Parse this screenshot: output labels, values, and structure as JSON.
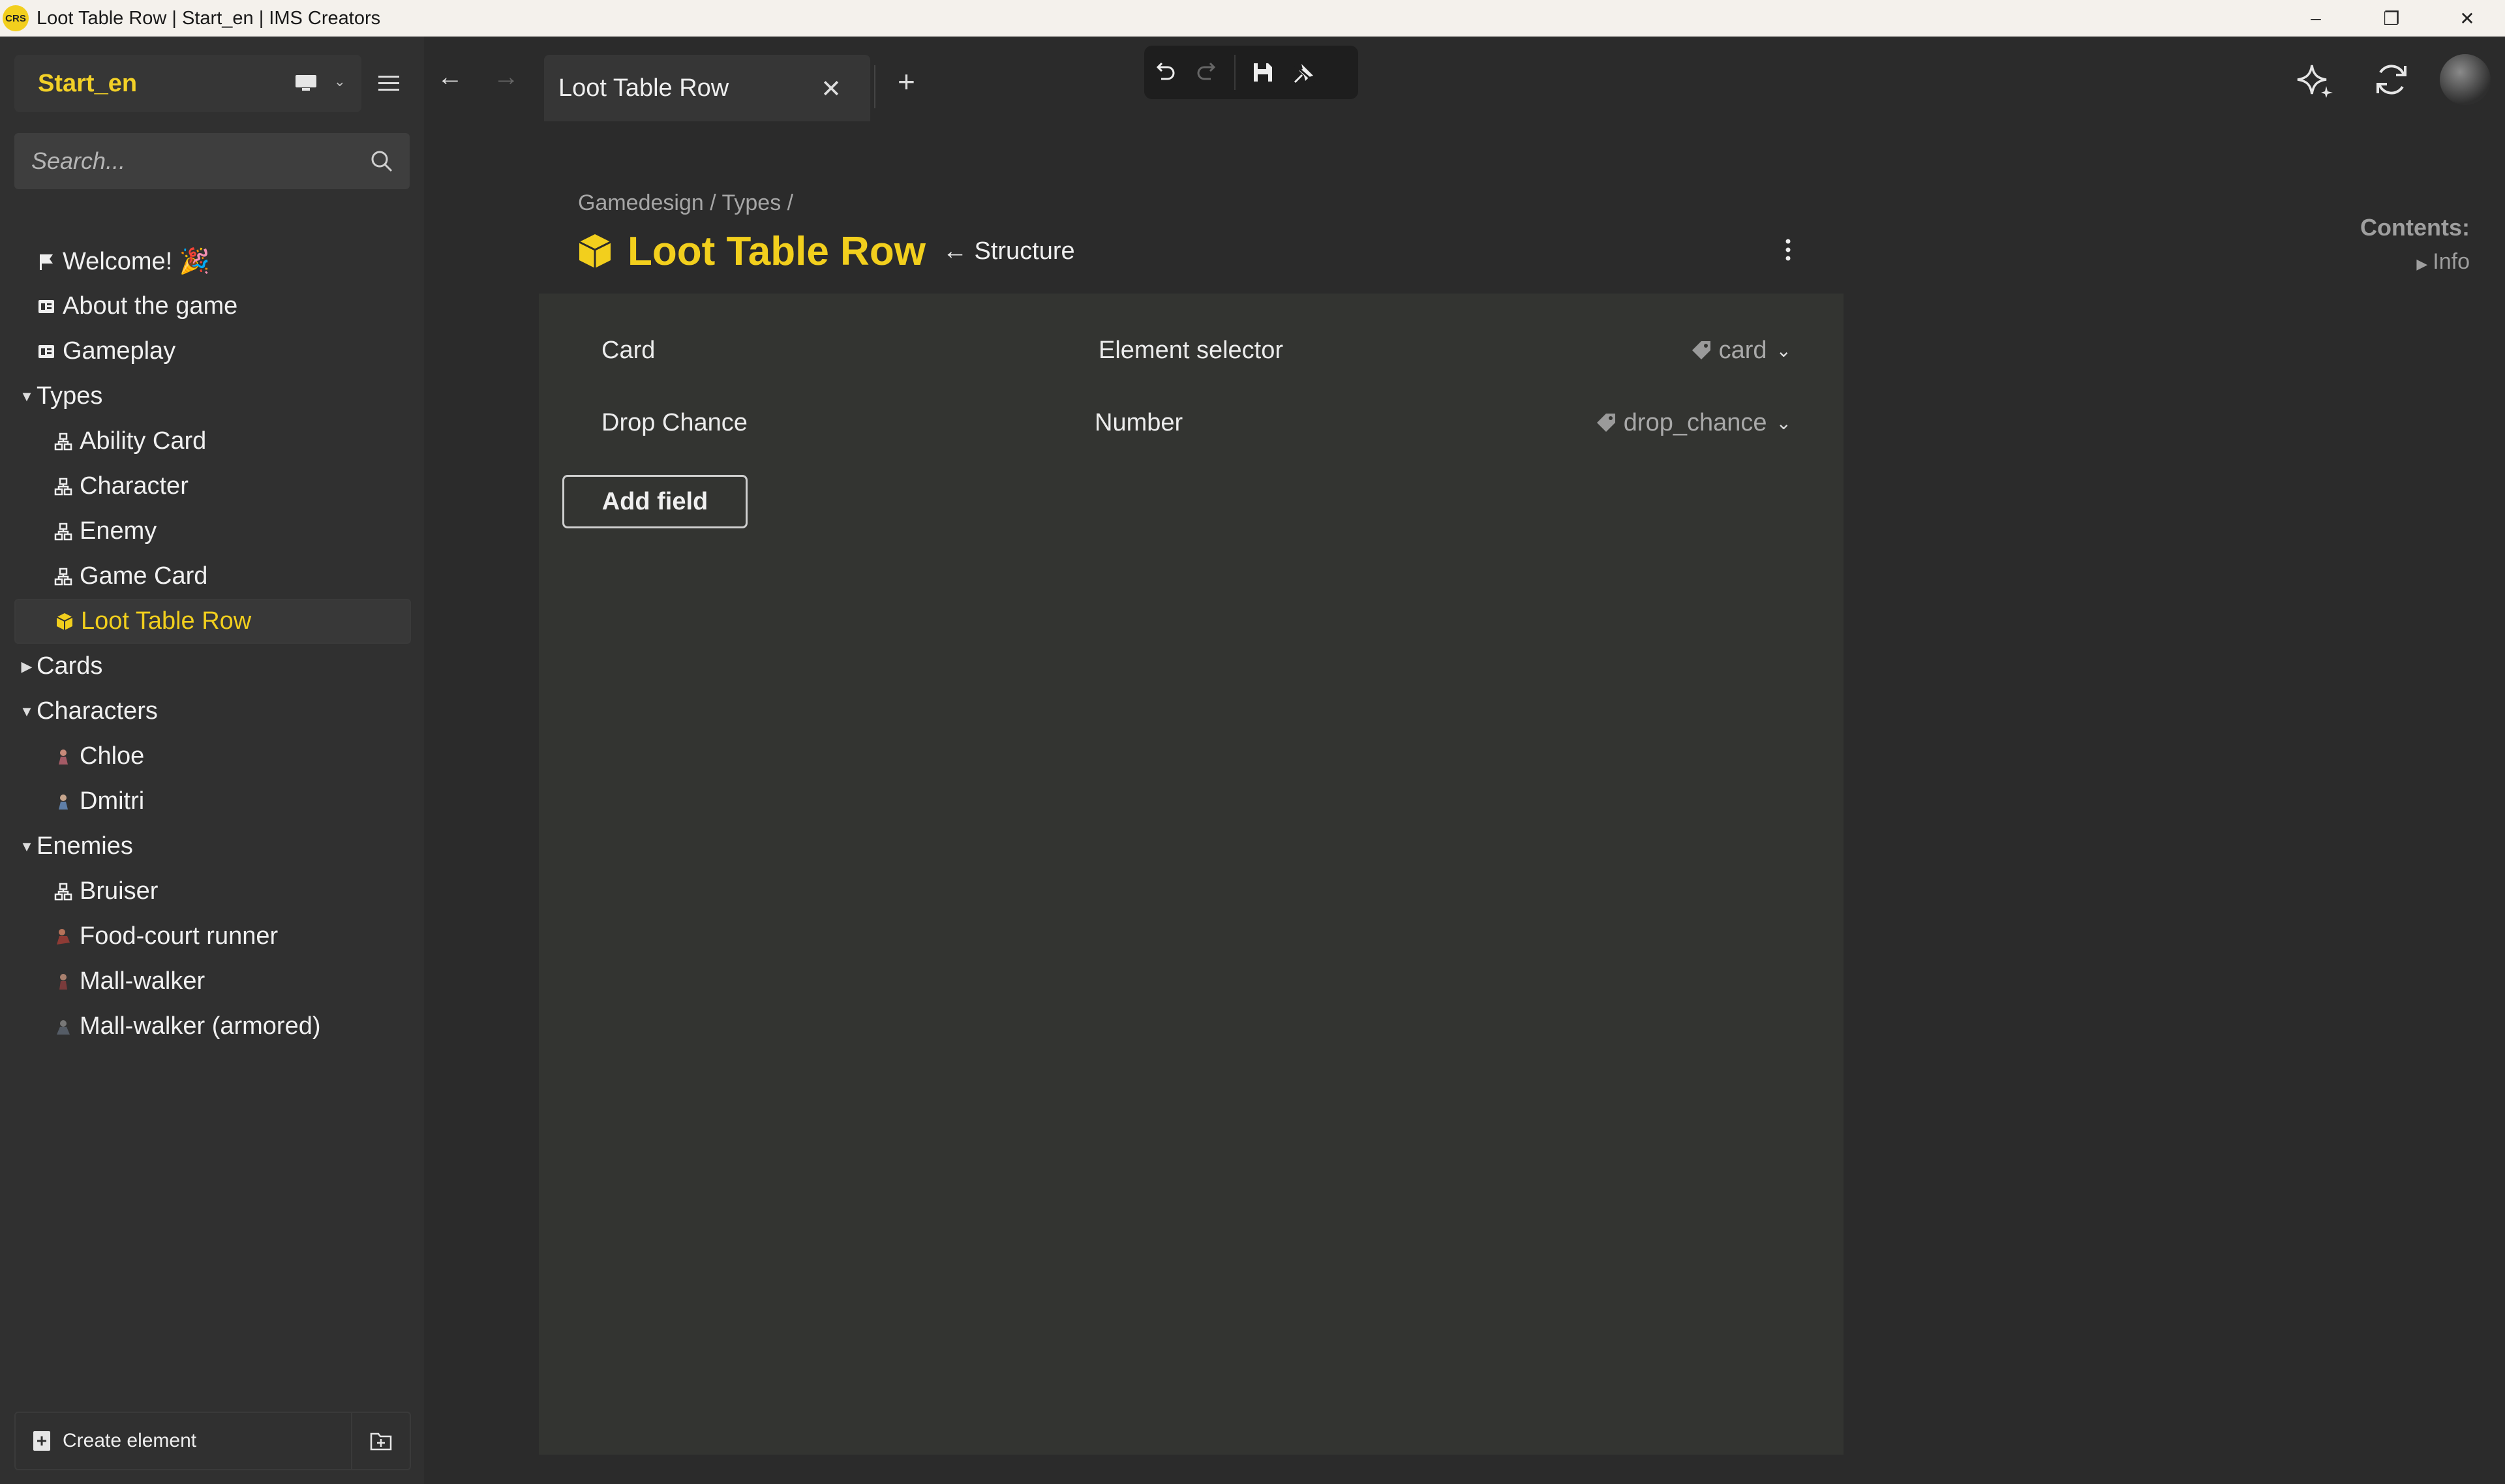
{
  "window": {
    "logo_text": "CRS",
    "title": "Loot Table Row | Start_en | IMS Creators",
    "controls": [
      "–",
      "❐",
      "✕"
    ]
  },
  "sidebar": {
    "project_name": "Start_en",
    "search": {
      "placeholder": "Search..."
    },
    "tree": [
      {
        "label": "Welcome! 🎉",
        "icon": "flag-icon",
        "level": 0
      },
      {
        "label": "About the game",
        "icon": "document-icon",
        "level": 0
      },
      {
        "label": "Gameplay",
        "icon": "document-icon",
        "level": 0
      },
      {
        "label": "Types",
        "icon": "caret-down-icon",
        "level": "folder",
        "expanded": true
      },
      {
        "label": "Ability Card",
        "icon": "type-icon",
        "level": 1
      },
      {
        "label": "Character",
        "icon": "type-icon",
        "level": 1
      },
      {
        "label": "Enemy",
        "icon": "type-icon",
        "level": 1
      },
      {
        "label": "Game Card",
        "icon": "type-icon",
        "level": 1
      },
      {
        "label": "Loot Table Row",
        "icon": "cube-icon",
        "level": 1,
        "active": true
      },
      {
        "label": "Cards",
        "icon": "caret-right-icon",
        "level": "folder",
        "expanded": false
      },
      {
        "label": "Characters",
        "icon": "caret-down-icon",
        "level": "folder",
        "expanded": true
      },
      {
        "label": "Chloe",
        "icon": "character-icon",
        "level": 1
      },
      {
        "label": "Dmitri",
        "icon": "character-icon",
        "level": 1
      },
      {
        "label": "Enemies",
        "icon": "caret-down-icon",
        "level": "folder",
        "expanded": true
      },
      {
        "label": "Bruiser",
        "icon": "type-icon",
        "level": 1
      },
      {
        "label": "Food-court runner",
        "icon": "character-icon",
        "level": 1
      },
      {
        "label": "Mall-walker",
        "icon": "character-icon",
        "level": 1
      },
      {
        "label": "Mall-walker (armored)",
        "icon": "character-icon",
        "level": 1
      }
    ],
    "footer": {
      "create_label": "Create element"
    }
  },
  "tabs": [
    {
      "label": "Loot Table Row",
      "active": true
    }
  ],
  "main": {
    "breadcrumb": "Gamedesign / Types /",
    "title": "Loot Table Row",
    "structure_link": "← Structure",
    "fields": [
      {
        "name": "Card",
        "type": "Element selector",
        "key": "card"
      },
      {
        "name": "Drop Chance",
        "type": "Number",
        "key": "drop_chance"
      }
    ],
    "add_field_label": "Add field"
  },
  "contents": {
    "title": "Contents:",
    "items": [
      "Info"
    ]
  },
  "colors": {
    "accent": "#f2cf1d",
    "background": "#2b2b2b",
    "sidebar": "#303030",
    "panel": "#333431"
  }
}
